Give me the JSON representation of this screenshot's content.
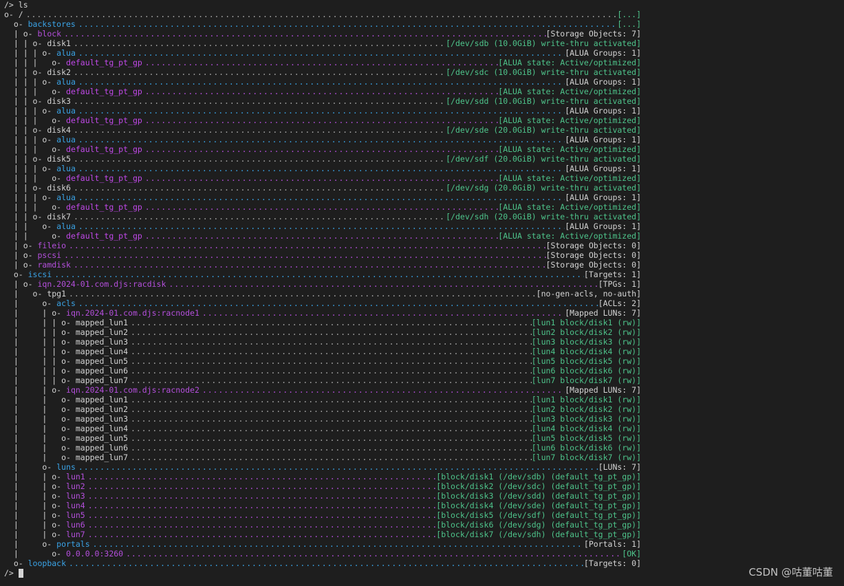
{
  "terminal": {
    "command_line": "/> ls",
    "prompt": "/>",
    "lines": [
      {
        "prefix": "o- ",
        "name": "/",
        "style": "node",
        "dots": "white",
        "status": "[...]",
        "status_style": "green"
      },
      {
        "prefix": "  o- ",
        "name": "backstores",
        "style": "cat",
        "dots": "cat",
        "status": "[...]",
        "status_style": "green"
      },
      {
        "prefix": "  | o- ",
        "name": "block",
        "style": "group",
        "dots": "magenta",
        "status": "[Storage Objects: 7]",
        "status_style": "plain"
      },
      {
        "prefix": "  | | o- ",
        "name": "disk1",
        "style": "node",
        "dots": "white",
        "status": "[/dev/sdb (10.0GiB) write-thru activated]",
        "status_style": "green"
      },
      {
        "prefix": "  | | | o- ",
        "name": "alua",
        "style": "cat",
        "dots": "cat",
        "status": "[ALUA Groups: 1]",
        "status_style": "plain"
      },
      {
        "prefix": "  | | |   o- ",
        "name": "default_tg_pt_gp",
        "style": "sub",
        "dots": "magenta",
        "status": "[ALUA state: Active/optimized]",
        "status_style": "green"
      },
      {
        "prefix": "  | | o- ",
        "name": "disk2",
        "style": "node",
        "dots": "white",
        "status": "[/dev/sdc (10.0GiB) write-thru activated]",
        "status_style": "green"
      },
      {
        "prefix": "  | | | o- ",
        "name": "alua",
        "style": "cat",
        "dots": "cat",
        "status": "[ALUA Groups: 1]",
        "status_style": "plain"
      },
      {
        "prefix": "  | | |   o- ",
        "name": "default_tg_pt_gp",
        "style": "sub",
        "dots": "magenta",
        "status": "[ALUA state: Active/optimized]",
        "status_style": "green"
      },
      {
        "prefix": "  | | o- ",
        "name": "disk3",
        "style": "node",
        "dots": "white",
        "status": "[/dev/sdd (10.0GiB) write-thru activated]",
        "status_style": "green"
      },
      {
        "prefix": "  | | | o- ",
        "name": "alua",
        "style": "cat",
        "dots": "cat",
        "status": "[ALUA Groups: 1]",
        "status_style": "plain"
      },
      {
        "prefix": "  | | |   o- ",
        "name": "default_tg_pt_gp",
        "style": "sub",
        "dots": "magenta",
        "status": "[ALUA state: Active/optimized]",
        "status_style": "green"
      },
      {
        "prefix": "  | | o- ",
        "name": "disk4",
        "style": "node",
        "dots": "white",
        "status": "[/dev/sde (20.0GiB) write-thru activated]",
        "status_style": "green"
      },
      {
        "prefix": "  | | | o- ",
        "name": "alua",
        "style": "cat",
        "dots": "cat",
        "status": "[ALUA Groups: 1]",
        "status_style": "plain"
      },
      {
        "prefix": "  | | |   o- ",
        "name": "default_tg_pt_gp",
        "style": "sub",
        "dots": "magenta",
        "status": "[ALUA state: Active/optimized]",
        "status_style": "green"
      },
      {
        "prefix": "  | | o- ",
        "name": "disk5",
        "style": "node",
        "dots": "white",
        "status": "[/dev/sdf (20.0GiB) write-thru activated]",
        "status_style": "green"
      },
      {
        "prefix": "  | | | o- ",
        "name": "alua",
        "style": "cat",
        "dots": "cat",
        "status": "[ALUA Groups: 1]",
        "status_style": "plain"
      },
      {
        "prefix": "  | | |   o- ",
        "name": "default_tg_pt_gp",
        "style": "sub",
        "dots": "magenta",
        "status": "[ALUA state: Active/optimized]",
        "status_style": "green"
      },
      {
        "prefix": "  | | o- ",
        "name": "disk6",
        "style": "node",
        "dots": "white",
        "status": "[/dev/sdg (20.0GiB) write-thru activated]",
        "status_style": "green"
      },
      {
        "prefix": "  | | | o- ",
        "name": "alua",
        "style": "cat",
        "dots": "cat",
        "status": "[ALUA Groups: 1]",
        "status_style": "plain"
      },
      {
        "prefix": "  | | |   o- ",
        "name": "default_tg_pt_gp",
        "style": "sub",
        "dots": "magenta",
        "status": "[ALUA state: Active/optimized]",
        "status_style": "green"
      },
      {
        "prefix": "  | | o- ",
        "name": "disk7",
        "style": "node",
        "dots": "white",
        "status": "[/dev/sdh (20.0GiB) write-thru activated]",
        "status_style": "green"
      },
      {
        "prefix": "  | |   o- ",
        "name": "alua",
        "style": "cat",
        "dots": "cat",
        "status": "[ALUA Groups: 1]",
        "status_style": "plain"
      },
      {
        "prefix": "  | |     o- ",
        "name": "default_tg_pt_gp",
        "style": "sub",
        "dots": "magenta",
        "status": "[ALUA state: Active/optimized]",
        "status_style": "green"
      },
      {
        "prefix": "  | o- ",
        "name": "fileio",
        "style": "group",
        "dots": "magenta",
        "status": "[Storage Objects: 0]",
        "status_style": "plain"
      },
      {
        "prefix": "  | o- ",
        "name": "pscsi",
        "style": "group",
        "dots": "magenta",
        "status": "[Storage Objects: 0]",
        "status_style": "plain"
      },
      {
        "prefix": "  | o- ",
        "name": "ramdisk",
        "style": "group",
        "dots": "magenta",
        "status": "[Storage Objects: 0]",
        "status_style": "plain"
      },
      {
        "prefix": "  o- ",
        "name": "iscsi",
        "style": "cat",
        "dots": "cat",
        "status": "[Targets: 1]",
        "status_style": "plain"
      },
      {
        "prefix": "  | o- ",
        "name": "iqn.2024-01.com.djs:racdisk",
        "style": "group",
        "dots": "magenta",
        "status": "[TPGs: 1]",
        "status_style": "plain"
      },
      {
        "prefix": "  |   o- ",
        "name": "tpg1",
        "style": "node",
        "dots": "white",
        "status": "[no-gen-acls, no-auth]",
        "status_style": "plain"
      },
      {
        "prefix": "  |     o- ",
        "name": "acls",
        "style": "cat",
        "dots": "cat",
        "status": "[ACLs: 2]",
        "status_style": "plain"
      },
      {
        "prefix": "  |     | o- ",
        "name": "iqn.2024-01.com.djs:racnode1",
        "style": "group",
        "dots": "magenta",
        "status": "[Mapped LUNs: 7]",
        "status_style": "plain"
      },
      {
        "prefix": "  |     | | o- ",
        "name": "mapped_lun1",
        "style": "node",
        "dots": "white",
        "status": "[lun1 block/disk1 (rw)]",
        "status_style": "green"
      },
      {
        "prefix": "  |     | | o- ",
        "name": "mapped_lun2",
        "style": "node",
        "dots": "white",
        "status": "[lun2 block/disk2 (rw)]",
        "status_style": "green"
      },
      {
        "prefix": "  |     | | o- ",
        "name": "mapped_lun3",
        "style": "node",
        "dots": "white",
        "status": "[lun3 block/disk3 (rw)]",
        "status_style": "green"
      },
      {
        "prefix": "  |     | | o- ",
        "name": "mapped_lun4",
        "style": "node",
        "dots": "white",
        "status": "[lun4 block/disk4 (rw)]",
        "status_style": "green"
      },
      {
        "prefix": "  |     | | o- ",
        "name": "mapped_lun5",
        "style": "node",
        "dots": "white",
        "status": "[lun5 block/disk5 (rw)]",
        "status_style": "green"
      },
      {
        "prefix": "  |     | | o- ",
        "name": "mapped_lun6",
        "style": "node",
        "dots": "white",
        "status": "[lun6 block/disk6 (rw)]",
        "status_style": "green"
      },
      {
        "prefix": "  |     | | o- ",
        "name": "mapped_lun7",
        "style": "node",
        "dots": "white",
        "status": "[lun7 block/disk7 (rw)]",
        "status_style": "green"
      },
      {
        "prefix": "  |     | o- ",
        "name": "iqn.2024-01.com.djs:racnode2",
        "style": "group",
        "dots": "magenta",
        "status": "[Mapped LUNs: 7]",
        "status_style": "plain"
      },
      {
        "prefix": "  |     |   o- ",
        "name": "mapped_lun1",
        "style": "node",
        "dots": "white",
        "status": "[lun1 block/disk1 (rw)]",
        "status_style": "green"
      },
      {
        "prefix": "  |     |   o- ",
        "name": "mapped_lun2",
        "style": "node",
        "dots": "white",
        "status": "[lun2 block/disk2 (rw)]",
        "status_style": "green"
      },
      {
        "prefix": "  |     |   o- ",
        "name": "mapped_lun3",
        "style": "node",
        "dots": "white",
        "status": "[lun3 block/disk3 (rw)]",
        "status_style": "green"
      },
      {
        "prefix": "  |     |   o- ",
        "name": "mapped_lun4",
        "style": "node",
        "dots": "white",
        "status": "[lun4 block/disk4 (rw)]",
        "status_style": "green"
      },
      {
        "prefix": "  |     |   o- ",
        "name": "mapped_lun5",
        "style": "node",
        "dots": "white",
        "status": "[lun5 block/disk5 (rw)]",
        "status_style": "green"
      },
      {
        "prefix": "  |     |   o- ",
        "name": "mapped_lun6",
        "style": "node",
        "dots": "white",
        "status": "[lun6 block/disk6 (rw)]",
        "status_style": "green"
      },
      {
        "prefix": "  |     |   o- ",
        "name": "mapped_lun7",
        "style": "node",
        "dots": "white",
        "status": "[lun7 block/disk7 (rw)]",
        "status_style": "green"
      },
      {
        "prefix": "  |     o- ",
        "name": "luns",
        "style": "cat",
        "dots": "cat",
        "status": "[LUNs: 7]",
        "status_style": "plain"
      },
      {
        "prefix": "  |     | o- ",
        "name": "lun1",
        "style": "group",
        "dots": "magenta",
        "status": "[block/disk1 (/dev/sdb) (default_tg_pt_gp)]",
        "status_style": "green"
      },
      {
        "prefix": "  |     | o- ",
        "name": "lun2",
        "style": "group",
        "dots": "magenta",
        "status": "[block/disk2 (/dev/sdc) (default_tg_pt_gp)]",
        "status_style": "green"
      },
      {
        "prefix": "  |     | o- ",
        "name": "lun3",
        "style": "group",
        "dots": "magenta",
        "status": "[block/disk3 (/dev/sdd) (default_tg_pt_gp)]",
        "status_style": "green"
      },
      {
        "prefix": "  |     | o- ",
        "name": "lun4",
        "style": "group",
        "dots": "magenta",
        "status": "[block/disk4 (/dev/sde) (default_tg_pt_gp)]",
        "status_style": "green"
      },
      {
        "prefix": "  |     | o- ",
        "name": "lun5",
        "style": "group",
        "dots": "magenta",
        "status": "[block/disk5 (/dev/sdf) (default_tg_pt_gp)]",
        "status_style": "green"
      },
      {
        "prefix": "  |     | o- ",
        "name": "lun6",
        "style": "group",
        "dots": "magenta",
        "status": "[block/disk6 (/dev/sdg) (default_tg_pt_gp)]",
        "status_style": "green"
      },
      {
        "prefix": "  |     | o- ",
        "name": "lun7",
        "style": "group",
        "dots": "magenta",
        "status": "[block/disk7 (/dev/sdh) (default_tg_pt_gp)]",
        "status_style": "green"
      },
      {
        "prefix": "  |     o- ",
        "name": "portals",
        "style": "cat",
        "dots": "cat",
        "status": "[Portals: 1]",
        "status_style": "plain"
      },
      {
        "prefix": "  |       o- ",
        "name": "0.0.0.0:3260",
        "style": "group",
        "dots": "magenta",
        "status": "[OK]",
        "status_style": "green"
      },
      {
        "prefix": "  o- ",
        "name": "loopback",
        "style": "cat",
        "dots": "cat",
        "status": "[Targets: 0]",
        "status_style": "plain"
      }
    ]
  },
  "watermark": "CSDN @咕董咕董",
  "colors": {
    "background": "#1e1e1e",
    "text": "#d4d4d4",
    "blue": "#3aa3e6",
    "magenta": "#b44fdc",
    "green": "#4ec48b"
  }
}
